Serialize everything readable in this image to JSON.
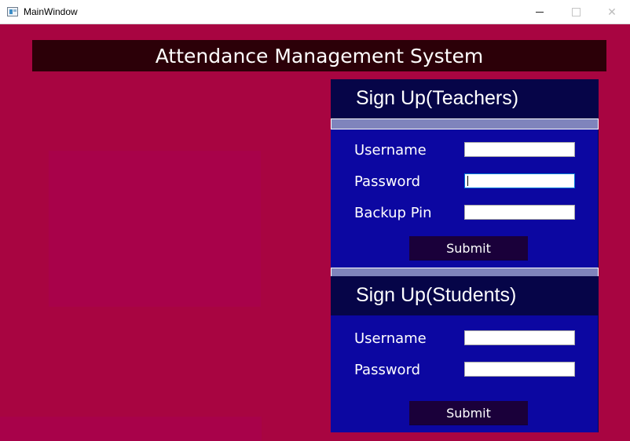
{
  "window": {
    "title": "MainWindow",
    "controls": [
      "minimize",
      "maximize",
      "close"
    ]
  },
  "header": {
    "title": "Attendance Management System"
  },
  "teachers": {
    "title": "Sign Up(Teachers)",
    "username_label": "Username",
    "password_label": "Password",
    "backup_pin_label": "Backup Pin",
    "username_value": "",
    "password_value": "",
    "backup_pin_value": "",
    "submit_label": "Submit"
  },
  "students": {
    "title": "Sign Up(Students)",
    "username_label": "Username",
    "password_label": "Password",
    "username_value": "",
    "password_value": "",
    "submit_label": "Submit"
  },
  "colors": {
    "background": "#a80541",
    "header_bar": "#2c0008",
    "panel": "#0c07a1",
    "section_header": "#060548",
    "separator": "#7f84bc",
    "button": "#1a003a"
  }
}
